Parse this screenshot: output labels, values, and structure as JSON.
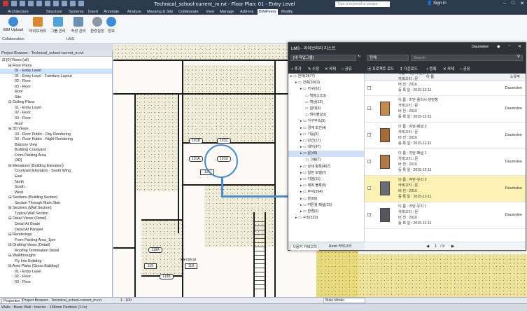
{
  "titlebar": {
    "title": "Technical_school-current_m.rvt - Floor Plan: 01 - Entry Level",
    "search_placeholder": "Type a keyword or phrase",
    "sign_in": "Sign In"
  },
  "ribbon_tabs": [
    "Architecture",
    "Structure",
    "Systems",
    "Insert",
    "Annotate",
    "Analyze",
    "Massing & Site",
    "Collaborate",
    "View",
    "Manage",
    "Add-Ins",
    "BIMPeers",
    "Modify"
  ],
  "ribbon": {
    "bim_upload": "BIM Upload",
    "lms_buttons": [
      "라이브러리",
      "그룹 관리",
      "속성 관리",
      "환경설정",
      "정보"
    ],
    "panel_collaboration": "Collaboration",
    "panel_lms": "LMS"
  },
  "project_browser": {
    "header": "Project Browser - Technical_school-current_m.rvt",
    "nodes": [
      {
        "label": "[0] Views (all)",
        "level": 0
      },
      {
        "label": "Floor Plans",
        "level": 1
      },
      {
        "label": "01 - Entry Level",
        "level": 2,
        "selected": true
      },
      {
        "label": "01 - Entry Level - Furniture Layout",
        "level": 2
      },
      {
        "label": "02 - Floor",
        "level": 2
      },
      {
        "label": "03 - Floor",
        "level": 2
      },
      {
        "label": "Roof",
        "level": 2
      },
      {
        "label": "Site",
        "level": 2
      },
      {
        "label": "Ceiling Plans",
        "level": 1
      },
      {
        "label": "01 - Entry Level",
        "level": 2
      },
      {
        "label": "02 - Floor",
        "level": 2
      },
      {
        "label": "03 - Floor",
        "level": 2
      },
      {
        "label": "Roof",
        "level": 2
      },
      {
        "label": "3D Views",
        "level": 1
      },
      {
        "label": "03 - Floor Public - Day Rendering",
        "level": 2
      },
      {
        "label": "03 - Floor Public - Night Rendering",
        "level": 2
      },
      {
        "label": "Balcony View",
        "level": 2
      },
      {
        "label": "Building Courtyard",
        "level": 2
      },
      {
        "label": "From Parking Area",
        "level": 2
      },
      {
        "label": "{3D}",
        "level": 2
      },
      {
        "label": "Elevations (Building Elevation)",
        "level": 1
      },
      {
        "label": "Courtyard Elevation - South Wing",
        "level": 2
      },
      {
        "label": "East",
        "level": 2
      },
      {
        "label": "North",
        "level": 2
      },
      {
        "label": "South",
        "level": 2
      },
      {
        "label": "West",
        "level": 2
      },
      {
        "label": "Sections (Building Section)",
        "level": 1
      },
      {
        "label": "Section Through Main Stair",
        "level": 2
      },
      {
        "label": "Sections (Wall Section)",
        "level": 1
      },
      {
        "label": "Typical Wall Section",
        "level": 2
      },
      {
        "label": "Detail Views (Detail)",
        "level": 1
      },
      {
        "label": "Detail At Grade",
        "level": 2
      },
      {
        "label": "Detail At Parapet",
        "level": 2
      },
      {
        "label": "Renderings",
        "level": 1
      },
      {
        "label": "From Parking Area_1pm",
        "level": 2
      },
      {
        "label": "Drafting Views (Detail)",
        "level": 1
      },
      {
        "label": "Roofing Termination Detail",
        "level": 2
      },
      {
        "label": "Walkthroughs",
        "level": 1
      },
      {
        "label": "Fly Into Building",
        "level": 2
      },
      {
        "label": "Area Plans (Gross Building)",
        "level": 1
      },
      {
        "label": "01 - Entry Level",
        "level": 2
      },
      {
        "label": "02 - Floor",
        "level": 2
      },
      {
        "label": "03 - Floor",
        "level": 2
      }
    ],
    "tabs": [
      "Properties",
      "Project Browser - Technical_school-current_m.rvt"
    ]
  },
  "canvas": {
    "door_tags": [
      "101B",
      "101C",
      "101A",
      "101D",
      "101",
      "119A",
      "119B"
    ],
    "rooms": [
      "Electrical",
      "118",
      "119"
    ],
    "scale": "1 : 100",
    "model_selector": "Main Model"
  },
  "status": "Walls : Basic Wall : Interior - 138mm Partition (1-hr)",
  "lms": {
    "title": "LMS - 라이브러리 리스트",
    "user": "Daumslee",
    "group_select": "[내 작업그룹]",
    "category_select": "전체",
    "search_placeholder": "Search",
    "tree_actions": [
      "추가",
      "수정",
      "삭제",
      "공유"
    ],
    "list_actions": [
      "프로젝트 로드",
      "다운로드",
      "등록",
      "삭제",
      "공유"
    ],
    "tree": [
      {
        "label": "전체(2877)",
        "level": 0
      },
      {
        "label": "건축(1063)",
        "level": 1
      },
      {
        "label": "가구(62)",
        "level": 2
      },
      {
        "label": "책장소(13)",
        "level": 3
      },
      {
        "label": "책상(13)",
        "level": 3
      },
      {
        "label": "침대(3)",
        "level": 3
      },
      {
        "label": "테이블(23)",
        "level": 3
      },
      {
        "label": "가구부속(9)",
        "level": 2
      },
      {
        "label": "경계 조건(4)",
        "level": 2
      },
      {
        "label": "기둥(5)",
        "level": 2
      },
      {
        "label": "난간(17)",
        "level": 2
      },
      {
        "label": "대지(47)",
        "level": 2
      },
      {
        "label": "문(49)",
        "level": 2,
        "selected": true
      },
      {
        "label": "그림(7)",
        "level": 3
      },
      {
        "label": "상세 항목(407)",
        "level": 2
      },
      {
        "label": "일반 모델(7)",
        "level": 2
      },
      {
        "label": "지붕(11)",
        "level": 2
      },
      {
        "label": "제목 블록(5)",
        "level": 2
      },
      {
        "label": "주석(294)",
        "level": 2
      },
      {
        "label": "창(69)",
        "level": 2
      },
      {
        "label": "커튼월 패널(13)",
        "level": 2
      },
      {
        "label": "환경(6)",
        "level": 2
      },
      {
        "label": "구조(323)",
        "level": 1
      }
    ],
    "left_tabs": [
      "사용자 카테고리",
      "Revit 카테고리"
    ],
    "list_header": {
      "name": "이 름",
      "owner": "소유주"
    },
    "items": [
      {
        "name": "이름 : 여닫이-문(...)",
        "category": "카테고리 : 문",
        "version": "버 전 : 2016",
        "date": "등 록 일 : 2015-12-11",
        "owner": "Daumslee",
        "selected": false,
        "partial": true
      },
      {
        "name": "이 름 : 미닫-플러시-양방향",
        "category": "카테고리 : 문",
        "version": "버 전 : 2016",
        "date": "등 록 일 : 2015-12-11",
        "owner": "Daumslee",
        "selected": false
      },
      {
        "name": "이 름 : 여닫-패널 2",
        "category": "카테고리 : 문",
        "version": "버 전 : 2016",
        "date": "등 록 일 : 2015-12-11",
        "owner": "Daumslee",
        "selected": false
      },
      {
        "name": "이 름 : 여닫-패널 1",
        "category": "카테고리 : 문",
        "version": "버 전 : 2016",
        "date": "등 록 일 : 2015-12-11",
        "owner": "Daumslee",
        "selected": false
      },
      {
        "name": "이 름 : 여닫-유리 2",
        "category": "카테고리 : 문",
        "version": "버 전 : 2016",
        "date": "등 록 일 : 2015-12-11",
        "owner": "Daumslee",
        "selected": true
      },
      {
        "name": "이 름 : 여닫-유리 1",
        "category": "카테고리 : 문",
        "version": "버 전 : 2016",
        "date": "등 록 일 : 2015-12-11",
        "owner": "Daumslee",
        "selected": false
      }
    ],
    "pager": {
      "page": "1",
      "total": "/ 9"
    }
  },
  "colors": {
    "accent": "#4a8bd6",
    "selected_row": "#fbf2b4",
    "dark_bar": "#2f3136"
  }
}
